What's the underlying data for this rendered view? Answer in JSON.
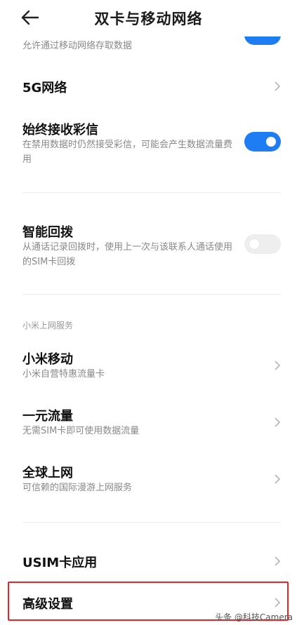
{
  "header": {
    "title": "双卡与移动网络"
  },
  "items": {
    "data_access_sub": "允许通过移动网络存取数据",
    "network_5g": "5G网络",
    "mms": {
      "label": "始终接收彩信",
      "sub": "在禁用数据时仍然接受彩信，可能会产生数据流量费用",
      "enabled": true
    },
    "redial": {
      "label": "智能回拨",
      "sub": "从通话记录回拨时，使用上一次与该联系人通话使用的SIM卡回拨",
      "enabled": false
    },
    "section_xiaomi": "小米上网服务",
    "xiaomi_mobile": {
      "label": "小米移动",
      "sub": "小米自营特惠流量卡"
    },
    "one_yuan": {
      "label": "一元流量",
      "sub": "无需SIM卡即可使用数据流量"
    },
    "global": {
      "label": "全球上网",
      "sub": "可信赖的国际漫游上网服务"
    },
    "usim": "USIM卡应用",
    "advanced": "高级设置"
  },
  "watermark": "头条 @科技Camera",
  "colors": {
    "accent": "#1f7df4",
    "highlight": "#e0262a"
  }
}
